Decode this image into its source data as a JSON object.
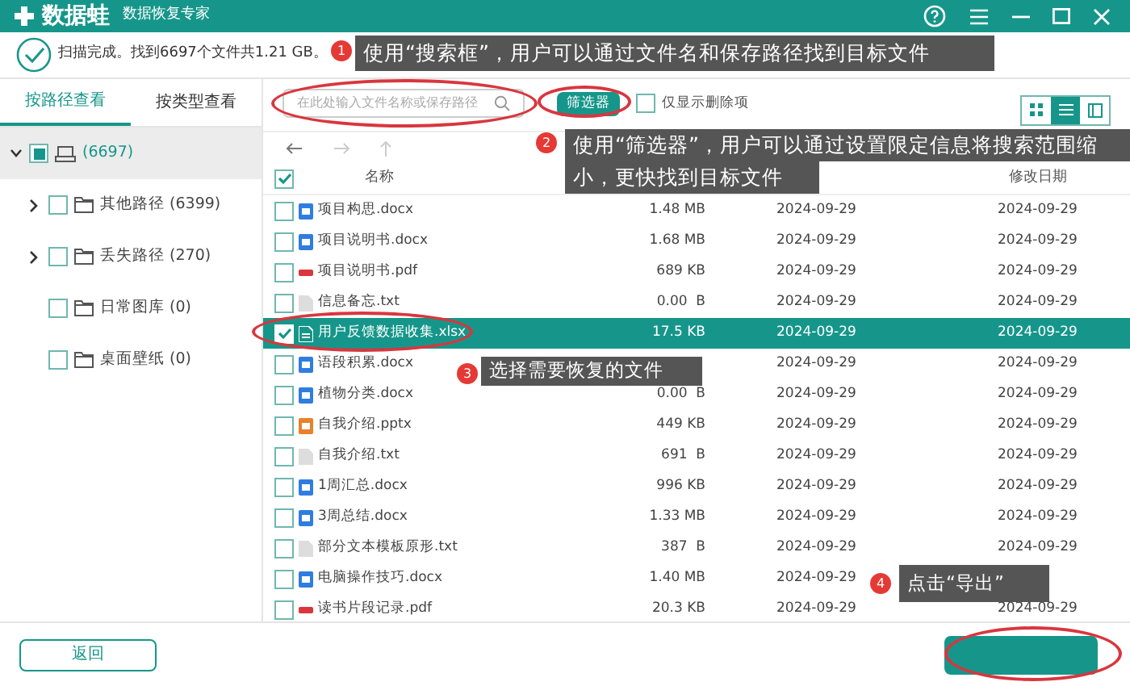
{
  "window": {
    "logo": "数据蛙",
    "subtitle": "数据恢复专家"
  },
  "status": "扫描完成。找到6697个文件共1.21 GB。",
  "view_tabs": [
    {
      "label": "按路径查看",
      "selected": true
    },
    {
      "label": "按类型查看",
      "selected": false
    }
  ],
  "tree": [
    {
      "kind": "drive",
      "label": "(6697)",
      "checked": false,
      "partial": true,
      "expanded": true,
      "selected": true,
      "children": [
        {
          "kind": "folder",
          "label": "其他路径 (6399)",
          "checked": false,
          "partial": false,
          "expanded": false,
          "selected": false
        },
        {
          "kind": "folder",
          "label": "丢失路径 (270)",
          "checked": false,
          "partial": false,
          "expanded": false,
          "selected": false
        },
        {
          "kind": "folder",
          "label": "日常图库 (0)",
          "checked": false,
          "partial": false,
          "selected": false
        },
        {
          "kind": "folder",
          "label": "桌面壁纸 (0)",
          "checked": false,
          "partial": false,
          "selected": false
        }
      ]
    }
  ],
  "search": {
    "placeholder": "在此处输入文件名称或保存路径"
  },
  "filter_button": "筛选器",
  "deleted_only": {
    "label": "仅显示删除项",
    "checked": false
  },
  "view_modes": [
    {
      "kind": "grid",
      "selected": false
    },
    {
      "kind": "list",
      "selected": true
    },
    {
      "kind": "detail",
      "selected": false
    }
  ],
  "table": {
    "header_checked": true,
    "columns": [
      "名称",
      "修改日期"
    ],
    "rows": [
      {
        "kind": "doc",
        "name": "项目构思.docx",
        "size": "1.48 MB",
        "created": "2024-09-29",
        "modified": "2024-09-29",
        "checked": false,
        "selected": false
      },
      {
        "kind": "doc",
        "name": "项目说明书.docx",
        "size": "1.68 MB",
        "created": "2024-09-29",
        "modified": "2024-09-29",
        "checked": false,
        "selected": false
      },
      {
        "kind": "pdf",
        "name": "项目说明书.pdf",
        "size": "689 KB",
        "created": "2024-09-29",
        "modified": "2024-09-29",
        "checked": false,
        "selected": false
      },
      {
        "kind": "txt",
        "name": "信息备忘.txt",
        "size": "0.00  B",
        "created": "2024-09-29",
        "modified": "2024-09-29",
        "checked": false,
        "selected": false
      },
      {
        "kind": "xls",
        "name": "用户反馈数据收集.xlsx",
        "size": "17.5 KB",
        "created": "2024-09-29",
        "modified": "2024-09-29",
        "checked": true,
        "selected": true
      },
      {
        "kind": "doc",
        "name": "语段积累.docx",
        "created": "2024-09-29",
        "modified": "2024-09-29",
        "checked": false,
        "selected": false
      },
      {
        "kind": "doc",
        "name": "植物分类.docx",
        "size": "0.00  B",
        "created": "2024-09-29",
        "modified": "2024-09-29",
        "checked": false,
        "selected": false
      },
      {
        "kind": "ppt",
        "name": "自我介绍.pptx",
        "size": "449 KB",
        "created": "2024-09-29",
        "modified": "2024-09-29",
        "checked": false,
        "selected": false
      },
      {
        "kind": "txt",
        "name": "自我介绍.txt",
        "size": "691  B",
        "created": "2024-09-29",
        "modified": "2024-09-29",
        "checked": false,
        "selected": false
      },
      {
        "kind": "doc",
        "name": "1周汇总.docx",
        "size": "996 KB",
        "created": "2024-09-29",
        "modified": "2024-09-29",
        "checked": false,
        "selected": false
      },
      {
        "kind": "doc",
        "name": "3周总结.docx",
        "size": "1.33 MB",
        "created": "2024-09-29",
        "modified": "2024-09-29",
        "checked": false,
        "selected": false
      },
      {
        "kind": "txt",
        "name": "部分文本模板原形.txt",
        "size": "387  B",
        "created": "2024-09-29",
        "modified": "2024-09-29",
        "checked": false,
        "selected": false
      },
      {
        "kind": "doc",
        "name": "电脑操作技巧.docx",
        "size": "1.40 MB",
        "created": "2024-09-29",
        "checked": false,
        "selected": false
      },
      {
        "kind": "pdf",
        "name": "读书片段记录.pdf",
        "size": "20.3 KB",
        "created": "2024-09-29",
        "modified": "2024-09-29",
        "checked": false,
        "selected": false
      }
    ]
  },
  "back_button": "返回",
  "annotations": [
    {
      "number": "1",
      "text": "使用“搜索框”，用户可以通过文件名和保存路径找到目标文件"
    },
    {
      "number": "2",
      "text": "使用“筛选器”，用户可以通过设置限定信息将搜索范围缩小，更快找到目标文件"
    },
    {
      "number": "3",
      "text": "选择需要恢复的文件"
    },
    {
      "number": "4",
      "text": "点击“导出”"
    }
  ]
}
